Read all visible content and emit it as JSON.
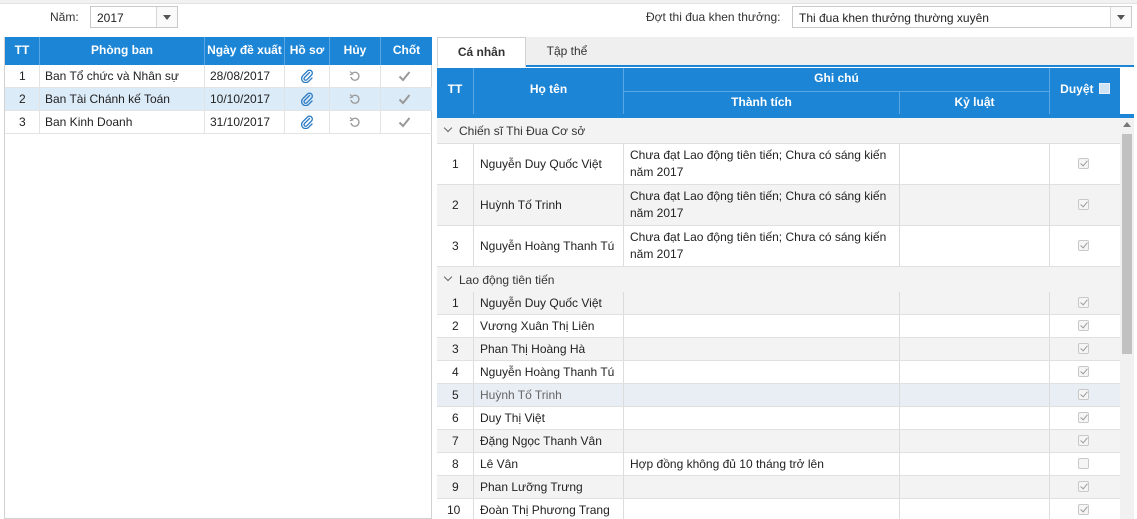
{
  "filter": {
    "year_label": "Năm:",
    "year_value": "2017",
    "round_label": "Đợt thi đua khen thưởng:",
    "round_value": "Thi đua khen thưởng thường xuyên"
  },
  "dept_grid": {
    "headers": [
      "TT",
      "Phòng ban",
      "Ngày đề xuất",
      "Hồ sơ",
      "Hủy",
      "Chốt"
    ],
    "rows": [
      {
        "tt": "1",
        "name": "Ban Tổ chức và Nhân sự",
        "date": "28/08/2017"
      },
      {
        "tt": "2",
        "name": "Ban Tài Chánh kế Toán",
        "date": "10/10/2017"
      },
      {
        "tt": "3",
        "name": "Ban Kinh Doanh",
        "date": "31/10/2017"
      }
    ]
  },
  "tabs": [
    "Cá nhân",
    "Tập thể"
  ],
  "detail_grid": {
    "headers": {
      "tt": "TT",
      "name": "Họ tên",
      "note": "Ghi chú",
      "achievement": "Thành tích",
      "discipline": "Kỷ luật",
      "approve": "Duyệt"
    },
    "groups": [
      {
        "title": "Chiến sĩ Thi Đua Cơ sở",
        "rows": [
          {
            "tt": "1",
            "name": "Nguyễn Duy Quốc Việt",
            "achievement_1": "Chưa đạt Lao động tiên tiến; Chưa có sáng kiến",
            "achievement_2": "năm 2017",
            "approved": true
          },
          {
            "tt": "2",
            "name": "Huỳnh Tố Trinh",
            "achievement_1": "Chưa đạt Lao động tiên tiến; Chưa có sáng kiến",
            "achievement_2": "năm 2017",
            "approved": true
          },
          {
            "tt": "3",
            "name": "Nguyễn Hoàng Thanh Tú",
            "achievement_1": "Chưa đạt Lao động tiên tiến; Chưa có sáng kiến",
            "achievement_2": "năm 2017",
            "approved": true
          }
        ]
      },
      {
        "title": "Lao động tiên tiến",
        "rows": [
          {
            "tt": "1",
            "name": "Nguyễn Duy Quốc Việt",
            "achievement": "",
            "approved": true
          },
          {
            "tt": "2",
            "name": "Vương Xuân Thị Liên",
            "achievement": "",
            "approved": true
          },
          {
            "tt": "3",
            "name": "Phan Thị Hoàng Hà",
            "achievement": "",
            "approved": true
          },
          {
            "tt": "4",
            "name": "Nguyễn Hoàng Thanh Tú",
            "achievement": "",
            "approved": true
          },
          {
            "tt": "5",
            "name": "Huỳnh Tố Trinh",
            "achievement": "",
            "approved": true
          },
          {
            "tt": "6",
            "name": "Duy Thị Việt",
            "achievement": "",
            "approved": true
          },
          {
            "tt": "7",
            "name": "Đặng Ngọc Thanh Vân",
            "achievement": "",
            "approved": true
          },
          {
            "tt": "8",
            "name": "Lê Vân",
            "achievement": "Hợp đồng không đủ 10 tháng trở lên",
            "approved": false
          },
          {
            "tt": "9",
            "name": "Phan Lưỡng Trưng",
            "achievement": "",
            "approved": true
          },
          {
            "tt": "10",
            "name": "Đoàn Thị Phương Trang",
            "achievement": "",
            "approved": true
          }
        ]
      }
    ]
  },
  "colors": {
    "header_blue": "#1c85d6",
    "selected_row": "#dcebf8"
  }
}
